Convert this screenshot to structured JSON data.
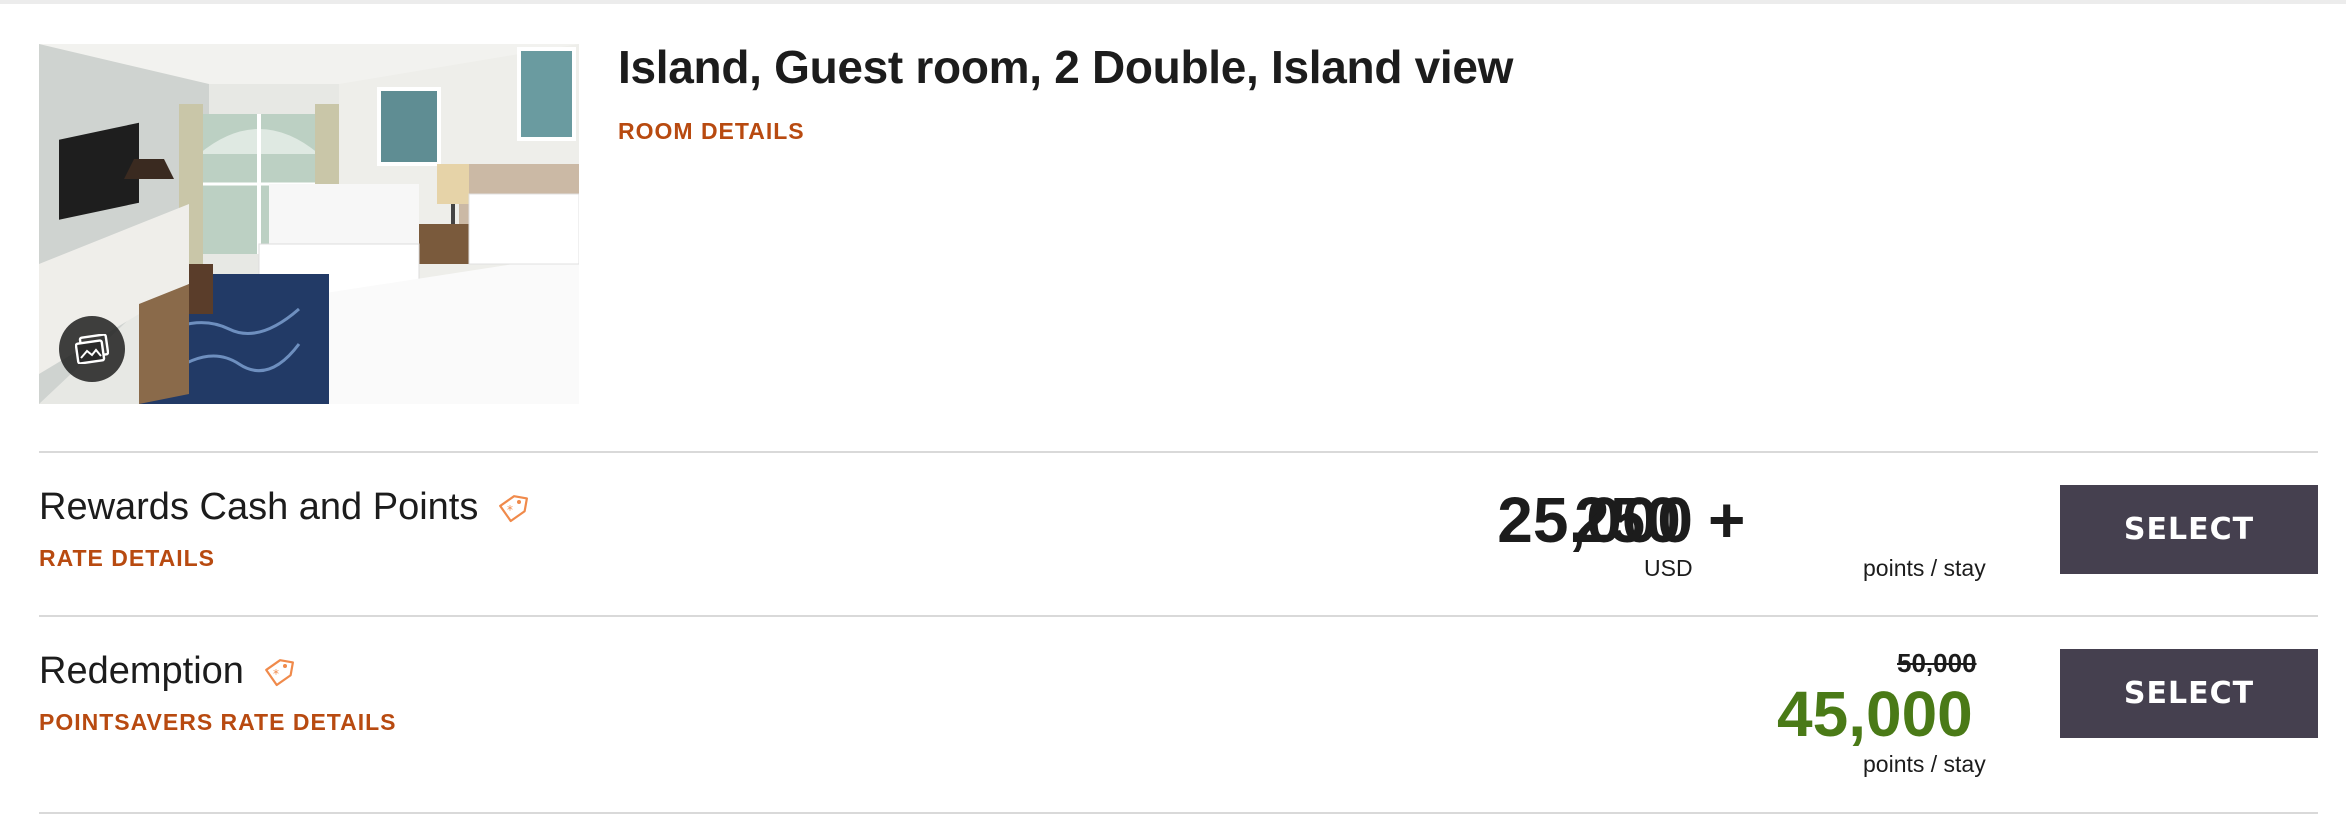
{
  "room": {
    "title": "Island, Guest room, 2 Double, Island view",
    "details_link": "ROOM DETAILS",
    "image_alt": "Guest room photo",
    "gallery_icon": "gallery-icon"
  },
  "rates": [
    {
      "name": "Rewards Cash and Points",
      "details_link": "RATE DETAILS",
      "tag_icon": "price-tag-icon",
      "cash_amount": "250",
      "plus": "+",
      "points_amount": "25,000",
      "cash_unit": "USD",
      "points_unit": "points / stay",
      "button": "SELECT"
    },
    {
      "name": "Redemption",
      "details_link": "POINTSAVERS RATE DETAILS",
      "tag_icon": "price-tag-icon",
      "original_points": "50,000",
      "points_amount": "45,000",
      "points_unit": "points / stay",
      "button": "SELECT"
    }
  ],
  "colors": {
    "link_orange": "#b84a10",
    "button_bg": "#45404f",
    "saver_green": "#4a7a17",
    "tag_orange": "#f08a4b"
  }
}
